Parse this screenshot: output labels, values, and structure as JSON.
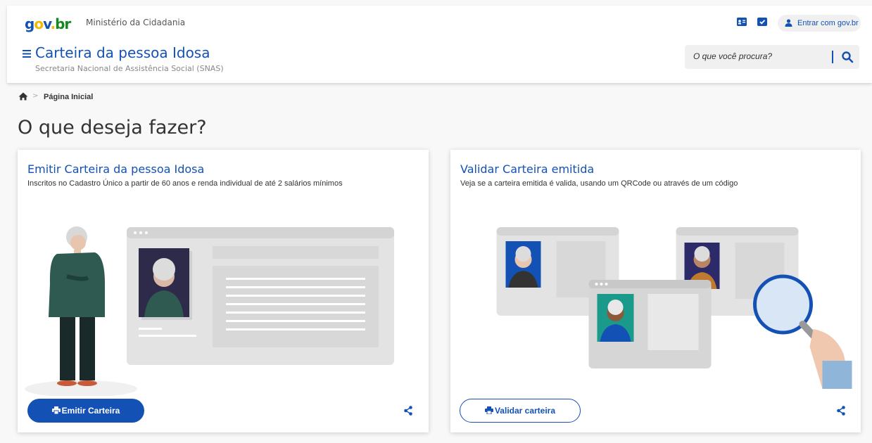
{
  "header": {
    "logo": {
      "g": "g",
      "o": "o",
      "v": "v",
      "dot": ".",
      "br": "br"
    },
    "ministry": "Ministério da Cidadania",
    "login_label": "Entrar com gov.br",
    "menu_icon": "hamburger-icon",
    "system_title": "Carteira da pessoa Idosa",
    "system_subtitle": "Secretaria Nacional de Assistência Social (SNAS)",
    "search_placeholder": "O que você procura?"
  },
  "breadcrumb": {
    "home_icon": "home-icon",
    "separator": ">",
    "current": "Página Inicial"
  },
  "page_title": "O que deseja fazer?",
  "cards": [
    {
      "title": "Emitir Carteira da pessoa Idosa",
      "description": "Inscritos no Cadastro Único a partir de 60 anos e renda individual de até 2 salários mínimos",
      "button": "Emitir Carteira",
      "button_icon": "printer-icon",
      "share_icon": "share-icon"
    },
    {
      "title": "Validar Carteira emitida",
      "description": "Veja se a carteira emitida é valida, usando um QRCode ou através de um código",
      "button": "Validar carteira",
      "button_icon": "printer-icon",
      "share_icon": "share-icon"
    }
  ],
  "colors": {
    "primary": "#1351b4",
    "background": "#f8f8f8",
    "card": "#ffffff",
    "text": "#333333"
  }
}
